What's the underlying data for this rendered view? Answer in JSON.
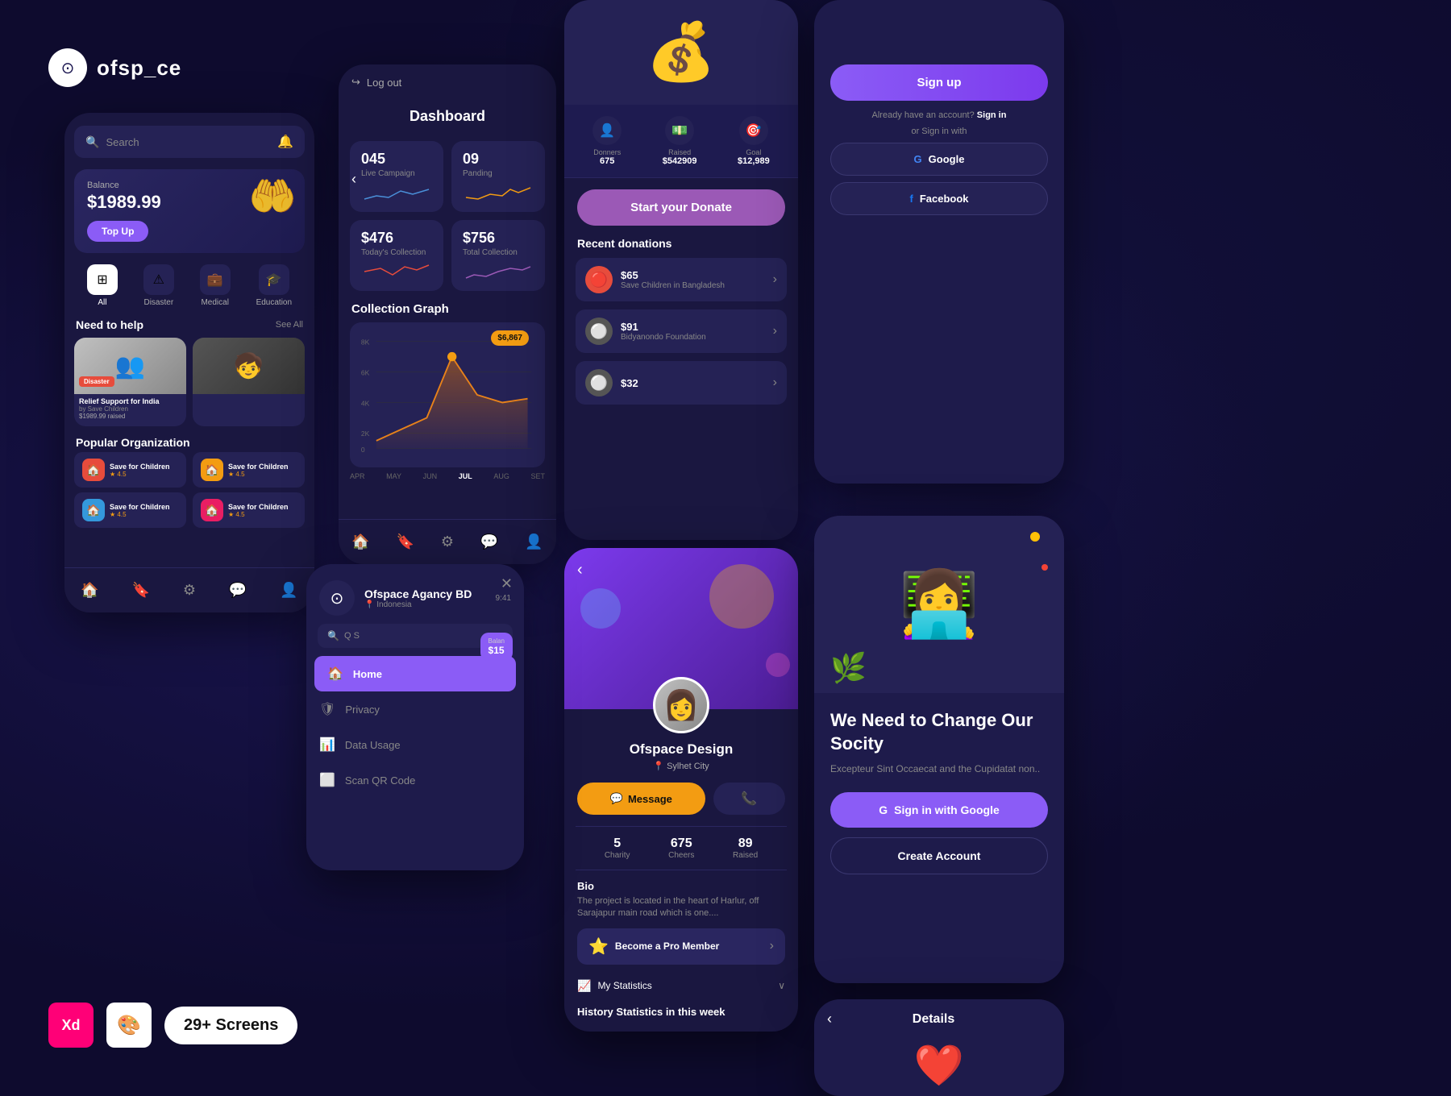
{
  "brand": {
    "name": "ofsp_ce",
    "logo_symbol": "⊙"
  },
  "badges": {
    "xd_label": "Xd",
    "screens_label": "29+ Screens"
  },
  "screen1": {
    "search_placeholder": "Search",
    "balance_label": "Balance",
    "balance_amount": "$1989.99",
    "topup_label": "Top Up",
    "categories": [
      {
        "icon": "⊞",
        "label": "All",
        "active": true
      },
      {
        "icon": "⚠",
        "label": "Disaster",
        "active": false
      },
      {
        "icon": "🏥",
        "label": "Medical",
        "active": false
      },
      {
        "icon": "🎓",
        "label": "Education",
        "active": false
      }
    ],
    "need_help_title": "Need to help",
    "see_all": "See All",
    "card1": {
      "badge": "Disaster",
      "title": "Relief Support for India",
      "sub": "by Save Children",
      "amount": "$1989.99 raised"
    },
    "popular_org_title": "Popular Organization",
    "orgs": [
      {
        "name": "Save for Children",
        "rating": "★ 4.5",
        "color": "red"
      },
      {
        "name": "Save for Children",
        "rating": "★ 4.5",
        "color": "yellow"
      },
      {
        "name": "Save for Children",
        "rating": "★ 4.5",
        "color": "blue"
      },
      {
        "name": "Save for Children",
        "rating": "★ 4.5",
        "color": "pink"
      }
    ]
  },
  "screen2": {
    "logout_label": "Log out",
    "title": "Dashboard",
    "stat1_number": "045",
    "stat1_label": "Live Campaign",
    "stat2_number": "09",
    "stat2_label": "Panding",
    "stat3_amount": "$476",
    "stat3_label": "Today's Collection",
    "stat4_amount": "$756",
    "stat4_label": "Total Collection",
    "graph_title": "Collection Graph",
    "tooltip_value": "$6,867",
    "month_labels": [
      "APR",
      "MAY",
      "JUN",
      "JUL",
      "AUG",
      "SET"
    ]
  },
  "screen3": {
    "donors_label": "Donners",
    "donors_val": "675",
    "raised_label": "Raised",
    "raised_val": "$542909",
    "goal_label": "Goal",
    "goal_val": "$12,989",
    "donate_btn": "Start your Donate",
    "recent_title": "Recent donations",
    "donations": [
      {
        "amount": "$65",
        "name": "Save Children in Bangladesh",
        "color": "red"
      },
      {
        "amount": "$91",
        "name": "Bidyanondo Foundation",
        "color": "gray"
      },
      {
        "amount": "$32",
        "name": "",
        "color": "gray"
      }
    ]
  },
  "screen4": {
    "name": "Ofspace Design",
    "location": "Sylhet City",
    "message_btn": "Message",
    "charity_val": "5",
    "charity_lbl": "Charity",
    "cheers_val": "675",
    "cheers_lbl": "Cheers",
    "raised_val": "89",
    "raised_lbl": "Raised",
    "bio_title": "Bio",
    "bio_text": "The project is located in the heart of Harlur, off Sarajapur main road which is one....",
    "pro_label": "Become a Pro Member",
    "stats_label": "My Statistics",
    "history_title": "History Statistics in this week"
  },
  "screen5": {
    "signup_label": "Sign up",
    "already_text": "Already have an account?",
    "signin_link": "Sign in",
    "or_text": "or Sign in with",
    "google_label": "Google",
    "facebook_label": "Facebook"
  },
  "screen6": {
    "title": "We Need to Change Our Socity",
    "subtitle": "Excepteur Sint Occaecat and the Cupidatat non..",
    "google_btn": "Sign in with Google",
    "create_btn": "Create Account"
  },
  "screen7": {
    "title": "Details"
  },
  "screen8": {
    "user_name": "Ofspace Agancy BD",
    "user_location": "Indonesia",
    "time": "9:41",
    "balance_label": "Balan",
    "balance_val": "$15",
    "menu_items": [
      {
        "icon": "🏠",
        "label": "Home",
        "active": true
      },
      {
        "icon": "🛡",
        "label": "Privacy",
        "active": false
      },
      {
        "icon": "📊",
        "label": "Data Usage",
        "active": false
      },
      {
        "icon": "⬜",
        "label": "Scan QR Code",
        "active": false
      }
    ]
  }
}
